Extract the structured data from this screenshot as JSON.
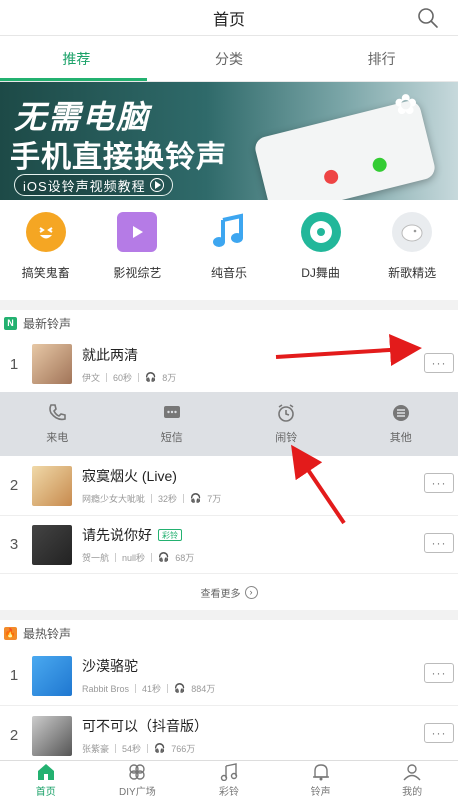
{
  "header": {
    "title": "首页"
  },
  "tabs": [
    {
      "label": "推荐",
      "active": true
    },
    {
      "label": "分类",
      "active": false
    },
    {
      "label": "排行",
      "active": false
    }
  ],
  "banner": {
    "line1": "无需电脑",
    "line2": "手机直接换铃声",
    "pill": "iOS设铃声视频教程"
  },
  "categories": [
    {
      "label": "搞笑鬼畜",
      "icon": "laugh-icon",
      "color": "#f5a623"
    },
    {
      "label": "影视综艺",
      "icon": "video-icon",
      "color": "#b57be6"
    },
    {
      "label": "纯音乐",
      "icon": "music-note-icon",
      "color": "#3da6f0"
    },
    {
      "label": "DJ舞曲",
      "icon": "disc-icon",
      "color": "#22b79a"
    },
    {
      "label": "新歌精选",
      "icon": "pig-icon",
      "color": "#e9ecef"
    }
  ],
  "newest": {
    "title": "最新铃声",
    "badge": "N",
    "songs": [
      {
        "index": "1",
        "name": "就此两清",
        "artist": "伊文",
        "duration": "60秒",
        "plays": "8万",
        "tag": ""
      },
      {
        "index": "2",
        "name": "寂寞烟火 (Live)",
        "artist": "网瘾少女大呲呲",
        "duration": "32秒",
        "plays": "7万",
        "tag": ""
      },
      {
        "index": "3",
        "name": "请先说你好",
        "artist": "贺一航",
        "duration": "null秒",
        "plays": "68万",
        "tag": "彩铃"
      }
    ],
    "actions": [
      {
        "label": "来电",
        "icon": "phone-icon"
      },
      {
        "label": "短信",
        "icon": "message-icon"
      },
      {
        "label": "闹铃",
        "icon": "alarm-clock-icon"
      },
      {
        "label": "其他",
        "icon": "menu-icon"
      }
    ],
    "see_more": "查看更多"
  },
  "hottest": {
    "title": "最热铃声",
    "songs": [
      {
        "index": "1",
        "name": "沙漠骆驼",
        "artist": "Rabbit Bros",
        "duration": "41秒",
        "plays": "884万"
      },
      {
        "index": "2",
        "name": "可不可以（抖音版）",
        "artist": "张紫豪",
        "duration": "54秒",
        "plays": "766万"
      }
    ]
  },
  "more_label": "···",
  "bottom_nav": [
    {
      "label": "首页",
      "icon": "home-icon",
      "active": true
    },
    {
      "label": "DIY广场",
      "icon": "diy-icon",
      "active": false
    },
    {
      "label": "彩铃",
      "icon": "music-icon",
      "active": false
    },
    {
      "label": "铃声",
      "icon": "bell-icon",
      "active": false
    },
    {
      "label": "我的",
      "icon": "user-icon",
      "active": false
    }
  ],
  "colors": {
    "accent": "#23b170",
    "annotation": "#e31b1b"
  }
}
